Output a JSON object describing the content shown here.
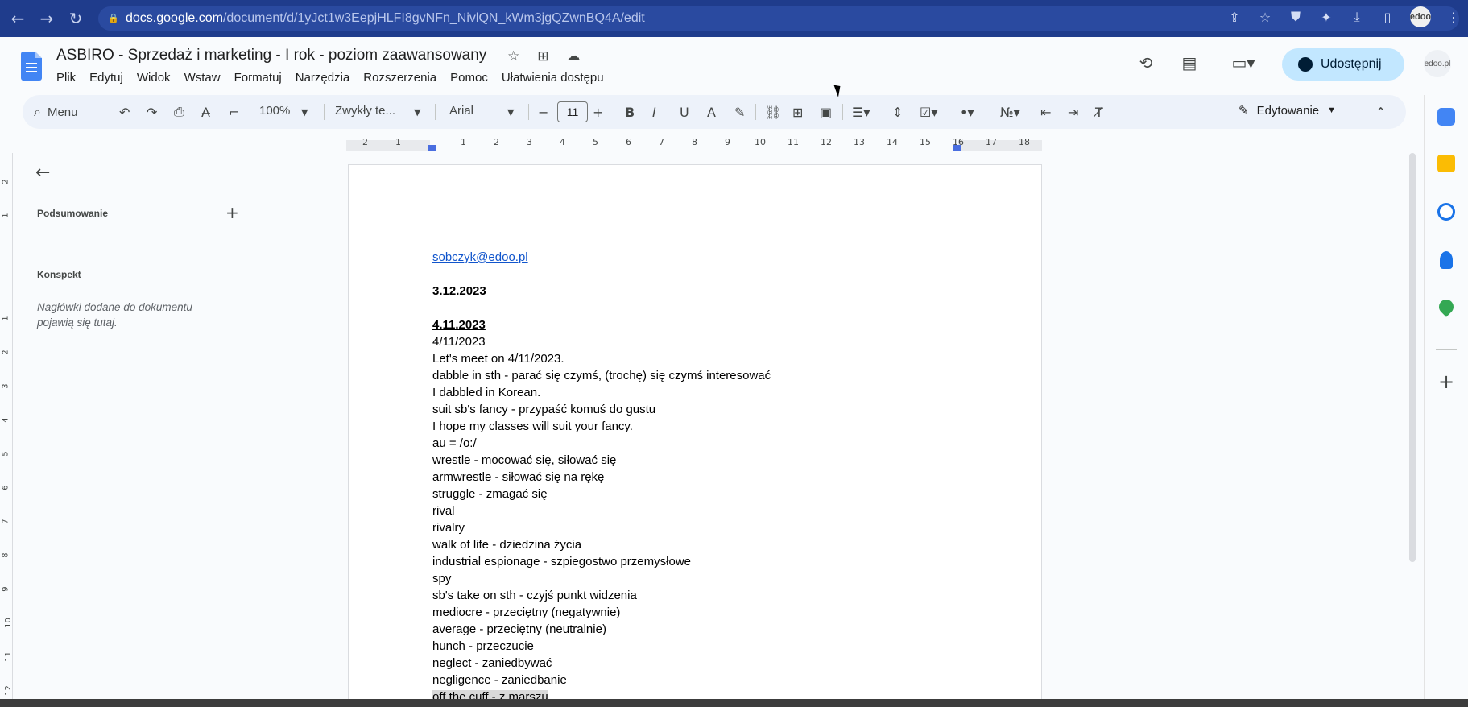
{
  "browser": {
    "url_host": "docs.google.com",
    "url_path": "/document/d/1yJct1w3EepjHLFI8gvNFn_NivlQN_kWm3jgQZwnBQ4A/edit",
    "profile_label": "edoo"
  },
  "doc": {
    "title": "ASBIRO - Sprzedaż i marketing - I rok - poziom zaawansowany",
    "menu": [
      "Plik",
      "Edytuj",
      "Widok",
      "Wstaw",
      "Formatuj",
      "Narzędzia",
      "Rozszerzenia",
      "Pomoc",
      "Ułatwienia dostępu"
    ],
    "share_label": "Udostępnij",
    "avatar_label": "edoo.pl"
  },
  "toolbar": {
    "search_label": "Menu",
    "zoom": "100%",
    "style": "Zwykły te...",
    "font": "Arial",
    "font_size": "11",
    "mode": "Edytowanie"
  },
  "ruler": {
    "numbers": [
      "2",
      "1",
      "1",
      "2",
      "3",
      "4",
      "5",
      "6",
      "7",
      "8",
      "9",
      "10",
      "11",
      "12",
      "13",
      "14",
      "15",
      "16",
      "17",
      "18"
    ]
  },
  "vruler": {
    "numbers": [
      "2",
      "1",
      "1",
      "2",
      "3",
      "4",
      "5",
      "6",
      "7",
      "8",
      "9",
      "10",
      "11",
      "12"
    ]
  },
  "outline": {
    "summary_label": "Podsumowanie",
    "outline_label": "Konspekt",
    "empty_note": "Nagłówki dodane do dokumentu pojawią się tutaj."
  },
  "content": {
    "email": "sobczyk@edoo.pl",
    "date1": "3.12.2023",
    "date2": "4.11.2023",
    "lines": [
      "4/11/2023",
      "Let's meet on 4/11/2023.",
      "dabble in sth - parać się czymś, (trochę) się czymś interesować",
      "I dabbled in Korean.",
      "suit sb's fancy - przypaść komuś do gustu",
      "I hope my classes will suit your fancy.",
      "au = /o:/",
      "wrestle - mocować się, siłować się",
      "armwrestle - siłować się na rękę",
      "struggle - zmagać się",
      "rival",
      "rivalry",
      "walk of life - dziedzina życia",
      "industrial espionage - szpiegostwo przemysłowe",
      "spy",
      "sb's take on sth - czyjś punkt widzenia",
      "mediocre - przeciętny (negatywnie)",
      "average - przeciętny (neutralnie)",
      "hunch - przeczucie",
      "neglect - zaniedbywać",
      "negligence - zaniedbanie"
    ],
    "highlighted_line": "off the cuff - z marszu"
  },
  "colors": {
    "browser_bar": "#1f3c8c",
    "share_button": "#c2e7ff",
    "link": "#1155cc"
  }
}
